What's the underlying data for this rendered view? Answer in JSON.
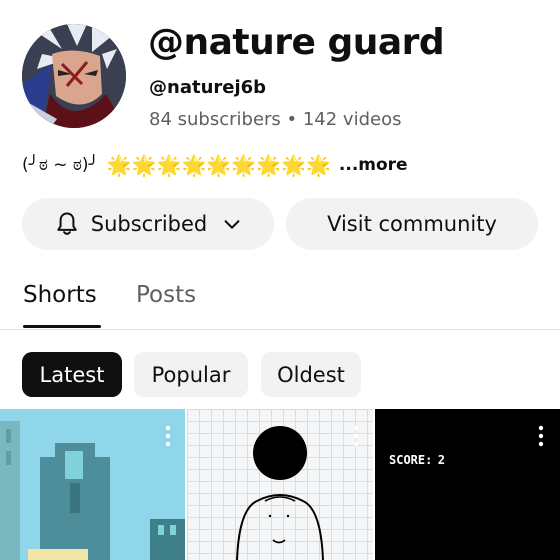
{
  "channel": {
    "name": "@nature guard",
    "handle": "@naturej6b",
    "stats": "84 subscribers • 142 videos",
    "description_prefix": "(╯ಠ ~ ಠ)╯",
    "description_stars": "🌟🌟🌟🌟🌟🌟🌟🌟🌟",
    "more_label": "...more"
  },
  "actions": {
    "subscribed_label": "Subscribed",
    "community_label": "Visit community"
  },
  "tabs": [
    {
      "label": "Shorts",
      "selected": true
    },
    {
      "label": "Posts",
      "selected": false
    }
  ],
  "filters": [
    {
      "label": "Latest",
      "selected": true
    },
    {
      "label": "Popular",
      "selected": false
    },
    {
      "label": "Oldest",
      "selected": false
    }
  ],
  "shorts": [
    {
      "kind": "pixel-city"
    },
    {
      "kind": "sketch-figure"
    },
    {
      "kind": "game",
      "score_label": "SCORE:",
      "score_value": "2"
    }
  ],
  "colors": {
    "text": "#0f0f0f",
    "secondary_text": "#606060",
    "chip_bg": "#f2f2f2",
    "chip_selected_bg": "#0f0f0f"
  },
  "icons": {
    "avatar": "anime-avatar",
    "bell": "bell-icon",
    "chevron": "chevron-down-icon",
    "menu": "more-vert-icon"
  }
}
